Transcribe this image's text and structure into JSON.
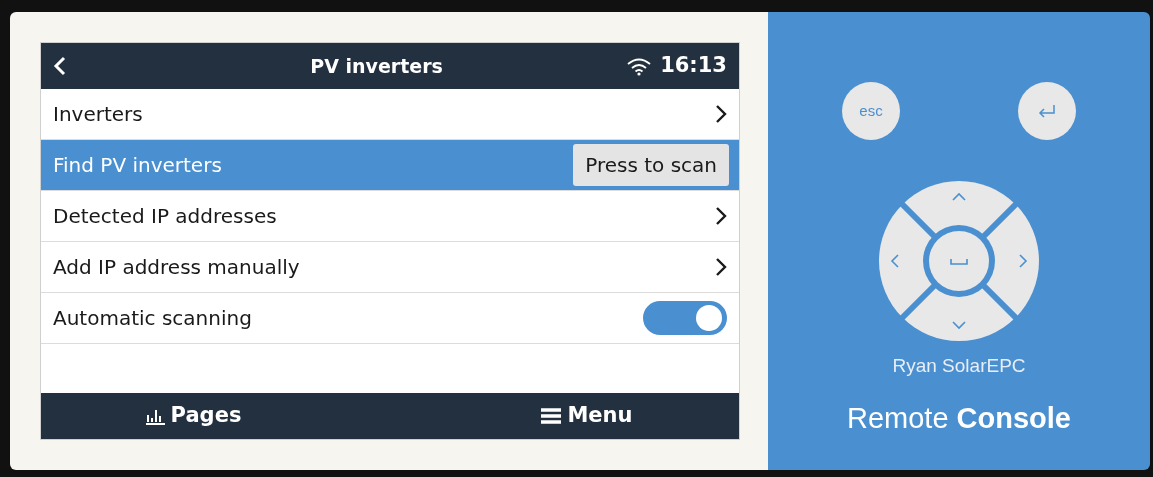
{
  "header": {
    "title": "PV inverters",
    "time": "16:13"
  },
  "rows": [
    {
      "label": "Inverters",
      "kind": "link",
      "selected": false
    },
    {
      "label": "Find PV inverters",
      "kind": "button",
      "button_label": "Press to scan",
      "selected": true
    },
    {
      "label": "Detected IP addresses",
      "kind": "link",
      "selected": false
    },
    {
      "label": "Add IP address manually",
      "kind": "link",
      "selected": false
    },
    {
      "label": "Automatic scanning",
      "kind": "toggle",
      "on": true,
      "selected": false
    }
  ],
  "footer": {
    "pages": "Pages",
    "menu": "Menu"
  },
  "remote": {
    "esc": "esc",
    "device_name": "Ryan SolarEPC",
    "brand_light": "Remote",
    "brand_bold": "Console"
  }
}
